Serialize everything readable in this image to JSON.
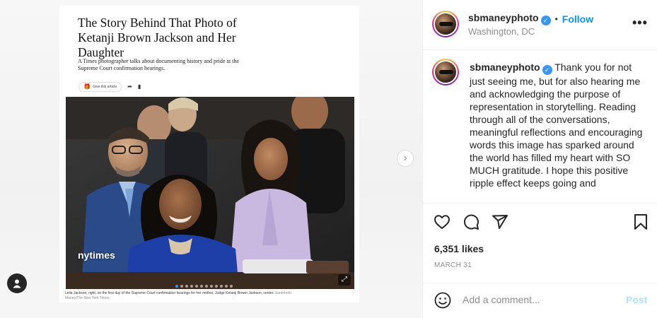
{
  "article": {
    "title": "The Story Behind That Photo of Ketanji Brown Jackson and Her Daughter",
    "subtitle": "A Times photographer talks about documenting history and pride at the Supreme Court confirmation hearings.",
    "gift_label": "Give this article",
    "caption": "Leila Jackson, right, on the first day of the Supreme Court confirmation hearings for her mother, Judge Ketanji Brown Jackson, center.",
    "credit": "Sarahbeth Maney/The New York Times"
  },
  "media": {
    "tag_label": "nytimes",
    "carousel_count": 12,
    "carousel_active": 0
  },
  "post_header": {
    "username": "sbmaneyphoto",
    "separator": "•",
    "follow_label": "Follow",
    "location": "Washington, DC"
  },
  "caption": {
    "username": "sbmaneyphoto",
    "text": "Thank you for not just seeing me, but for also hearing me and acknowledging the purpose of representation in storytelling. Reading through all of the conversations, meaningful reflections and encouraging words this image has sparked around the world has filled my heart with SO MUCH gratitude. I hope this positive ripple effect keeps going and"
  },
  "engagement": {
    "likes": "6,351 likes",
    "date": "MARCH 31"
  },
  "comment_box": {
    "placeholder": "Add a comment...",
    "post_label": "Post"
  },
  "colors": {
    "accent": "#0095f6",
    "verified": "#3897f0",
    "post_disabled": "#b2dffc"
  }
}
